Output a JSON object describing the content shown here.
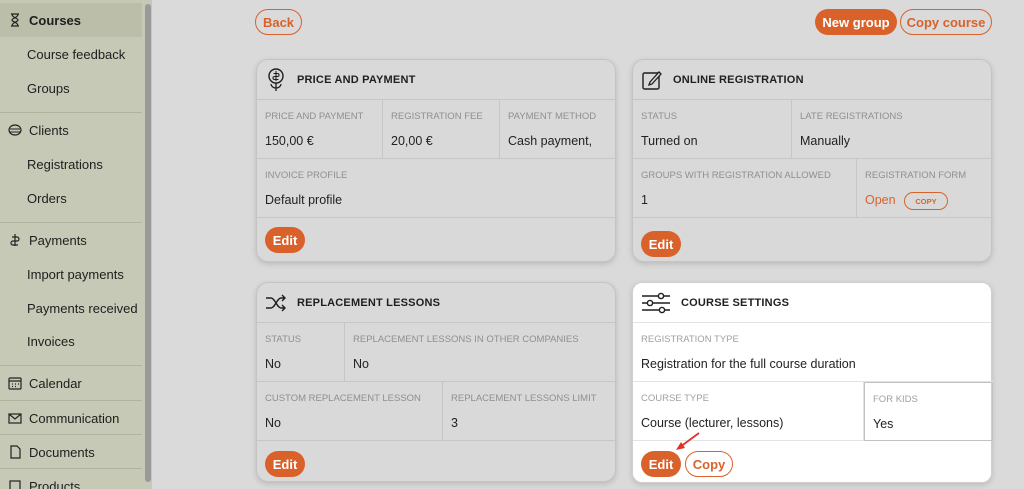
{
  "sidebar": {
    "items": [
      {
        "label": "Courses",
        "icon": "hourglass-icon",
        "type": "top",
        "active": true
      },
      {
        "label": "Course feedback",
        "type": "sub"
      },
      {
        "label": "Groups",
        "type": "sub"
      },
      {
        "label": "Clients",
        "icon": "clients-icon",
        "type": "top"
      },
      {
        "label": "Registrations",
        "type": "sub"
      },
      {
        "label": "Orders",
        "type": "sub"
      },
      {
        "label": "Payments",
        "icon": "payments-icon",
        "type": "top"
      },
      {
        "label": "Import payments",
        "type": "sub"
      },
      {
        "label": "Payments received",
        "type": "sub"
      },
      {
        "label": "Invoices",
        "type": "sub"
      },
      {
        "label": "Calendar",
        "icon": "calendar-icon",
        "type": "top"
      },
      {
        "label": "Communication",
        "icon": "envelope-icon",
        "type": "top"
      },
      {
        "label": "Documents",
        "icon": "document-icon",
        "type": "top"
      },
      {
        "label": "Products",
        "icon": "product-icon",
        "type": "top"
      }
    ]
  },
  "toolbar": {
    "back_label": "Back",
    "new_group_label": "New group",
    "copy_course_label": "Copy course"
  },
  "price_card": {
    "title": "PRICE AND PAYMENT",
    "fields": [
      {
        "label": "PRICE AND PAYMENT",
        "value": "150,00 €"
      },
      {
        "label": "REGISTRATION FEE",
        "value": "20,00 €"
      },
      {
        "label": "PAYMENT METHOD",
        "value": "Cash payment,"
      },
      {
        "label": "INVOICE PROFILE",
        "value": "Default profile"
      }
    ],
    "edit_label": "Edit"
  },
  "online_card": {
    "title": "ONLINE REGISTRATION",
    "fields": [
      {
        "label": "STATUS",
        "value": "Turned on"
      },
      {
        "label": "LATE REGISTRATIONS",
        "value": "Manually"
      },
      {
        "label": "GROUPS WITH REGISTRATION ALLOWED",
        "value": "1"
      },
      {
        "label": "REGISTRATION FORM",
        "value": "Open"
      }
    ],
    "copy_label": "COPY",
    "edit_label": "Edit"
  },
  "replacement_card": {
    "title": "REPLACEMENT LESSONS",
    "fields": [
      {
        "label": "STATUS",
        "value": "No"
      },
      {
        "label": "REPLACEMENT LESSONS IN OTHER COMPANIES",
        "value": "No"
      },
      {
        "label": "CUSTOM REPLACEMENT LESSON",
        "value": "No"
      },
      {
        "label": "REPLACEMENT LESSONS LIMIT",
        "value": "3"
      }
    ],
    "edit_label": "Edit"
  },
  "settings_card": {
    "title": "COURSE SETTINGS",
    "fields": [
      {
        "label": "REGISTRATION TYPE",
        "value": "Registration for the full course duration"
      },
      {
        "label": "COURSE TYPE",
        "value": "Course (lecturer, lessons)"
      },
      {
        "label": "FOR KIDS",
        "value": "Yes"
      }
    ],
    "edit_label": "Edit",
    "copy_label": "Copy"
  },
  "colors": {
    "accent": "#d9622b",
    "sidebar_bg": "#c6c9b5",
    "overlay_bg": "#dadada",
    "annotation_arrow": "#e0322a"
  }
}
